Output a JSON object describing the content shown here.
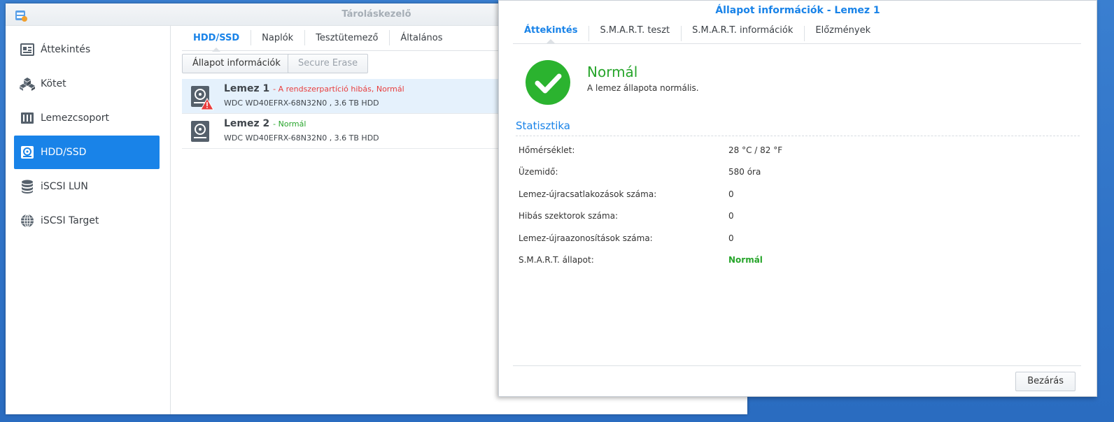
{
  "main_window": {
    "title": "Tároláskezelő"
  },
  "sidebar": {
    "items": [
      {
        "label": "Áttekintés",
        "icon": "overview-icon"
      },
      {
        "label": "Kötet",
        "icon": "volume-icon"
      },
      {
        "label": "Lemezcsoport",
        "icon": "disk-group-icon"
      },
      {
        "label": "HDD/SSD",
        "icon": "hdd-icon",
        "active": true
      },
      {
        "label": "iSCSI LUN",
        "icon": "database-icon"
      },
      {
        "label": "iSCSI Target",
        "icon": "globe-icon"
      }
    ]
  },
  "main_tabs": [
    "HDD/SSD",
    "Naplók",
    "Tesztütemező",
    "Általános"
  ],
  "toolbar": {
    "status_info": "Állapot információk",
    "secure_erase": "Secure Erase"
  },
  "disks": [
    {
      "name": "Lemez 1",
      "status": "- A rendszerpartíció hibás, Normál",
      "model": "WDC WD40EFRX-68N32N0 , 3.6 TB HDD"
    },
    {
      "name": "Lemez 2",
      "status": "- Normál",
      "model": "WDC WD40EFRX-68N32N0 , 3.6 TB HDD"
    }
  ],
  "dialog": {
    "title": "Állapot információk - Lemez 1",
    "tabs": [
      "Áttekintés",
      "S.M.A.R.T. teszt",
      "S.M.A.R.T. információk",
      "Előzmények"
    ],
    "status_title": "Normál",
    "status_desc": "A lemez állapota normális.",
    "section_title": "Statisztika",
    "stats": [
      {
        "label": "Hőmérséklet:",
        "value": "28 °C / 82 °F"
      },
      {
        "label": "Üzemidő:",
        "value": "580 óra"
      },
      {
        "label": "Lemez-újracsatlakozások száma:",
        "value": "0"
      },
      {
        "label": "Hibás szektorok száma:",
        "value": "0"
      },
      {
        "label": "Lemez-újraazonosítások száma:",
        "value": "0"
      },
      {
        "label": "S.M.A.R.T. állapot:",
        "value": "Normál"
      }
    ],
    "close_label": "Bezárás"
  },
  "colors": {
    "accent": "#1983e8",
    "ok": "#27a52b",
    "error": "#e83e3e"
  }
}
